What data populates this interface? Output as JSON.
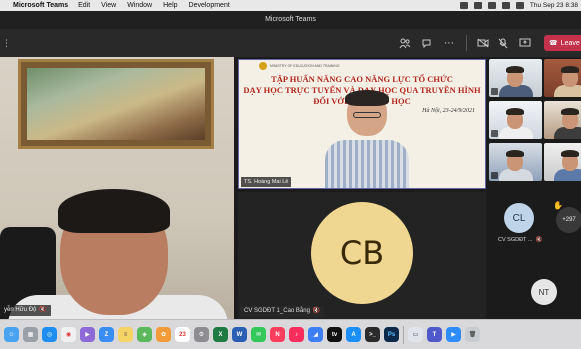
{
  "menubar": {
    "app_name": "Microsoft Teams",
    "items": [
      "Edit",
      "View",
      "Window",
      "Help",
      "Development"
    ],
    "clock": "Thu Sep 23  8:38"
  },
  "window": {
    "title": "Microsoft Teams"
  },
  "toolbar": {
    "leave_label": "Leave",
    "participants_icon": "people-icon",
    "chat_icon": "chat-icon",
    "more_icon": "more-options-icon",
    "camera_icon": "camera-off-icon",
    "mic_icon": "mic-off-icon",
    "share_icon": "share-screen-icon",
    "leave_color": "#c4314b"
  },
  "left_video": {
    "name": "yễn Hữu Độ"
  },
  "shared_screen": {
    "ministry": "MINISTRY OF EDUCATION AND TRAINING",
    "title_lines": [
      "TẬP HUẤN NÂNG CAO NĂNG LỰC TỔ CHỨC",
      "DẠY HỌC TRỰC TUYẾN VÀ DẠY HỌC QUA TRUYỀN HÌNH",
      "ĐỐI VỚI CẤP TIỂU HỌC"
    ],
    "date": "Hà Nội, 23-24/9/2021",
    "presenter": "TS. Hoàng Mai Lê"
  },
  "tiles": {
    "big": {
      "initials": "CB",
      "name": "CV SGDĐT 1_Cao Bằng",
      "color": "#f0d791"
    },
    "cl": {
      "initials": "CL",
      "name": "CV SGDĐT ...",
      "color": "#bfd4e9"
    },
    "more": {
      "count": "+297"
    },
    "nt": {
      "initials": "NT"
    }
  },
  "dock": {
    "calendar_day": "23",
    "items": [
      "finder-icon",
      "launchpad-icon",
      "safari-icon",
      "chrome-icon",
      "facetime-icon",
      "zalo-icon",
      "notes-icon",
      "maps-icon",
      "photos-icon",
      "calendar-icon",
      "settings-icon",
      "excel-icon",
      "word-icon",
      "messages-icon",
      "music-icon",
      "news-icon",
      "keynote-icon",
      "tv-icon",
      "app-store-icon",
      "terminal-icon",
      "photoshop-icon",
      "preview-icon",
      "teams-icon",
      "zoom-icon",
      "trash-icon"
    ]
  }
}
